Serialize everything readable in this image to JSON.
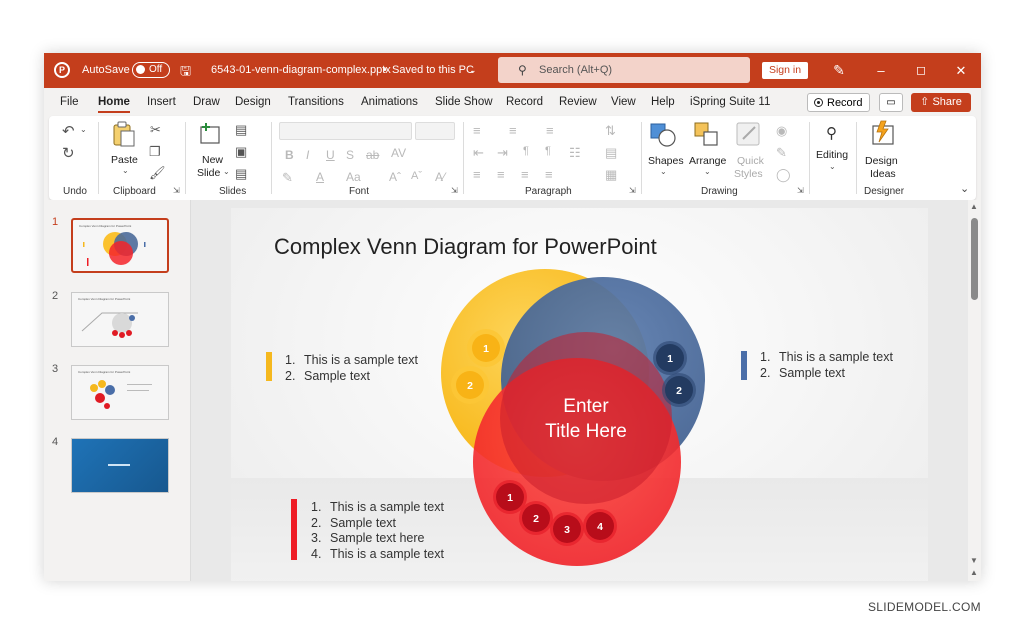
{
  "titlebar": {
    "autosave_label": "AutoSave",
    "autosave_state": "Off",
    "filename": "6543-01-venn-diagram-complex.pptx",
    "saved_status": "Saved to this PC",
    "search_placeholder": "Search (Alt+Q)",
    "signin_label": "Sign in",
    "accent_color": "#c43e1c"
  },
  "tabs": [
    "File",
    "Home",
    "Insert",
    "Draw",
    "Design",
    "Transitions",
    "Animations",
    "Slide Show",
    "Record",
    "Review",
    "View",
    "Help",
    "iSpring Suite 11"
  ],
  "active_tab": "Home",
  "actions": {
    "record": "Record",
    "share": "Share"
  },
  "ribbon": {
    "groups": {
      "undo": "Undo",
      "clipboard": "Clipboard",
      "slides": "Slides",
      "font": "Font",
      "paragraph": "Paragraph",
      "drawing": "Drawing",
      "designer": "Designer"
    },
    "buttons": {
      "paste": "Paste",
      "new_slide_1": "New",
      "new_slide_2": "Slide",
      "shapes": "Shapes",
      "arrange": "Arrange",
      "quick_1": "Quick",
      "quick_2": "Styles",
      "editing": "Editing",
      "design_1": "Design",
      "design_2": "Ideas"
    }
  },
  "thumbnails": [
    {
      "number": "1",
      "title": "Complex Venn Diagram for PowerPoint",
      "active": true
    },
    {
      "number": "2",
      "title": "Complex Venn Diagram for PowerPoint",
      "active": false
    },
    {
      "number": "3",
      "title": "Complex Venn Diagram for PowerPoint",
      "active": false
    },
    {
      "number": "4",
      "title": "",
      "active": false
    }
  ],
  "slide": {
    "title": "Complex Venn Diagram for PowerPoint",
    "left_list": {
      "color": "#f5b81e",
      "items": [
        "This is a sample text",
        "Sample text"
      ]
    },
    "right_list": {
      "color": "#4a6ea8",
      "items": [
        "This is a sample text",
        "Sample text"
      ]
    },
    "bottom_list": {
      "color": "#ee1c25",
      "items": [
        "This is a sample text",
        "Sample text",
        "Sample text here",
        "This is a sample text"
      ]
    },
    "center_line1": "Enter",
    "center_line2": "Title Here",
    "yellow_badges": [
      "1",
      "2"
    ],
    "blue_badges": [
      "1",
      "2"
    ],
    "red_badges": [
      "1",
      "2",
      "3",
      "4"
    ],
    "circle_colors": {
      "yellow": "#fbbf24",
      "blue": "#4c6b9a",
      "red": "#f5242a"
    }
  },
  "watermark": "SLIDEMODEL.COM"
}
